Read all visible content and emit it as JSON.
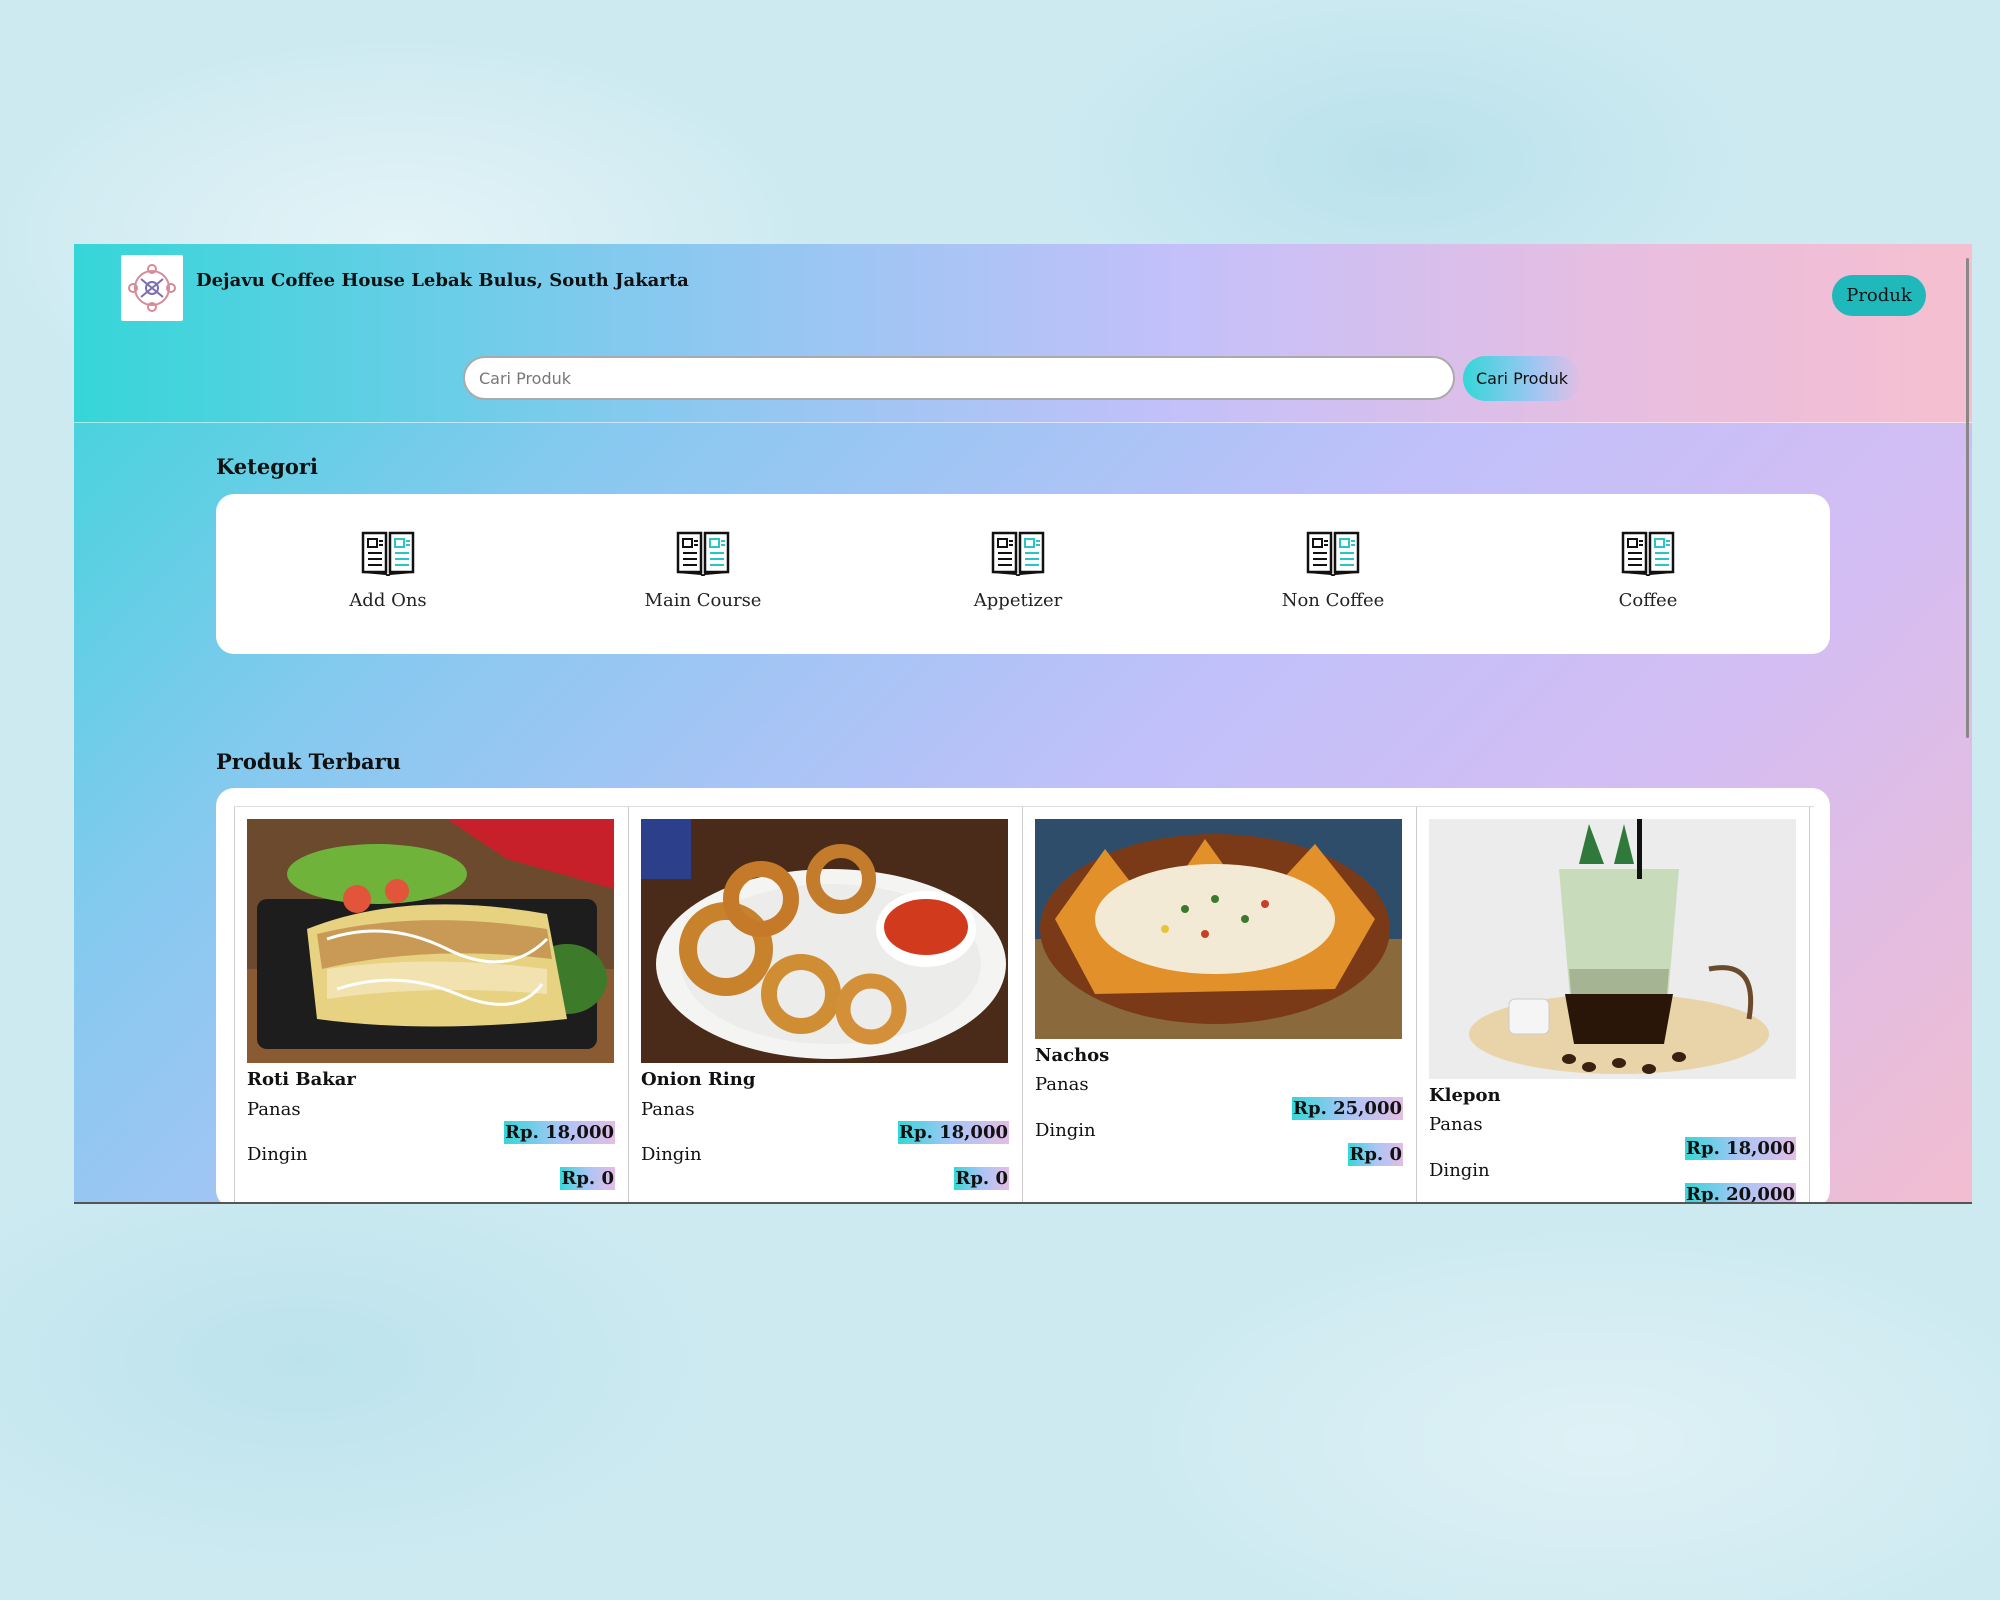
{
  "header": {
    "brand": "Dejavu Coffee House Lebak Bulus, South Jakarta",
    "produk_label": "Produk"
  },
  "search": {
    "placeholder": "Cari Produk",
    "button_label": "Cari Produk"
  },
  "categories": {
    "title": "Ketegori",
    "items": [
      {
        "label": "Add Ons",
        "icon": "menu-book-icon"
      },
      {
        "label": "Main Course",
        "icon": "menu-book-icon"
      },
      {
        "label": "Appetizer",
        "icon": "menu-book-icon"
      },
      {
        "label": "Non Coffee",
        "icon": "menu-book-icon"
      },
      {
        "label": "Coffee",
        "icon": "menu-book-icon"
      }
    ]
  },
  "products": {
    "title": "Produk Terbaru",
    "items": [
      {
        "name": "Roti Bakar",
        "hot_label": "Panas",
        "hot_price": "Rp. 18,000",
        "cold_label": "Dingin",
        "cold_price": "Rp. 0"
      },
      {
        "name": "Onion Ring",
        "hot_label": "Panas",
        "hot_price": "Rp. 18,000",
        "cold_label": "Dingin",
        "cold_price": "Rp. 0"
      },
      {
        "name": "Nachos",
        "hot_label": "Panas",
        "hot_price": "Rp. 25,000",
        "cold_label": "Dingin",
        "cold_price": "Rp. 0"
      },
      {
        "name": "Klepon",
        "hot_label": "Panas",
        "hot_price": "Rp. 18,000",
        "cold_label": "Dingin",
        "cold_price": "Rp. 20,000"
      }
    ]
  },
  "colors": {
    "accent": "#1fb8bb",
    "gradient_start": "#35d6d8",
    "gradient_end": "#f2bdd0"
  }
}
